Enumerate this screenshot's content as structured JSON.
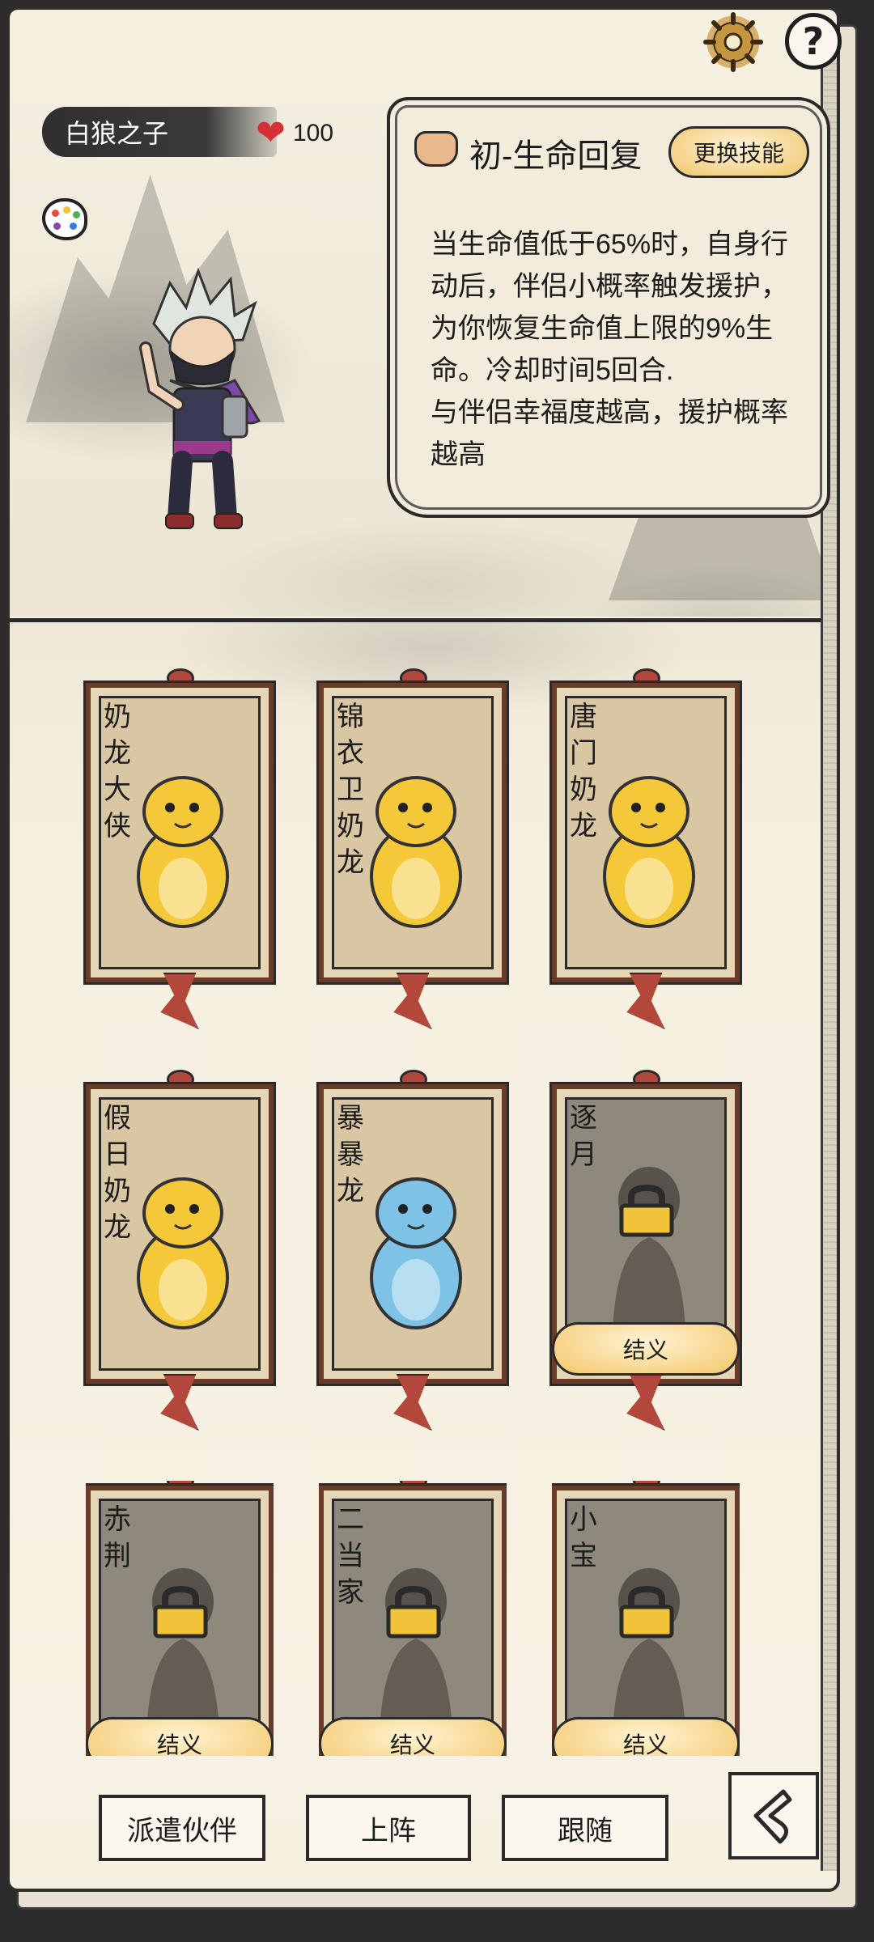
{
  "header": {
    "settings_icon": "gear-icon",
    "help_icon": "question-icon",
    "help_symbol": "?"
  },
  "hero": {
    "name": "白狼之子",
    "hp": "100",
    "heart_icon": "heart-icon",
    "palette_icon": "palette-icon"
  },
  "skill": {
    "title": "初-生命回复",
    "change_button": "更换技能",
    "description": "当生命值低于65%时，自身行动后，伴侣小概率触发援护，为你恢复生命值上限的9%生命。冷却时间5回合.\n与伴侣幸福度越高，援护概率越高"
  },
  "companions": [
    {
      "name": "奶\n龙\n大\n侠",
      "locked": false,
      "color": "#f5c83a"
    },
    {
      "name": "锦\n衣\n卫\n奶\n龙",
      "locked": false,
      "color": "#f5c83a"
    },
    {
      "name": "唐\n门\n奶\n龙",
      "locked": false,
      "color": "#f5c83a"
    },
    {
      "name": "假\n日\n奶\n龙",
      "locked": false,
      "color": "#f5c83a"
    },
    {
      "name": "暴\n暴\n龙",
      "locked": false,
      "color": "#7ec3e6"
    },
    {
      "name": "逐\n月",
      "locked": true,
      "bond": "结义"
    },
    {
      "name": "赤\n荆",
      "locked": true,
      "bond": "结义"
    },
    {
      "name": "二\n当\n家",
      "locked": true,
      "bond": "结义"
    },
    {
      "name": "小\n宝",
      "locked": true,
      "bond": "结义"
    }
  ],
  "actions": {
    "dispatch": "派遣伙伴",
    "deploy": "上阵",
    "follow": "跟随",
    "back_icon": "back-arrow-icon"
  }
}
